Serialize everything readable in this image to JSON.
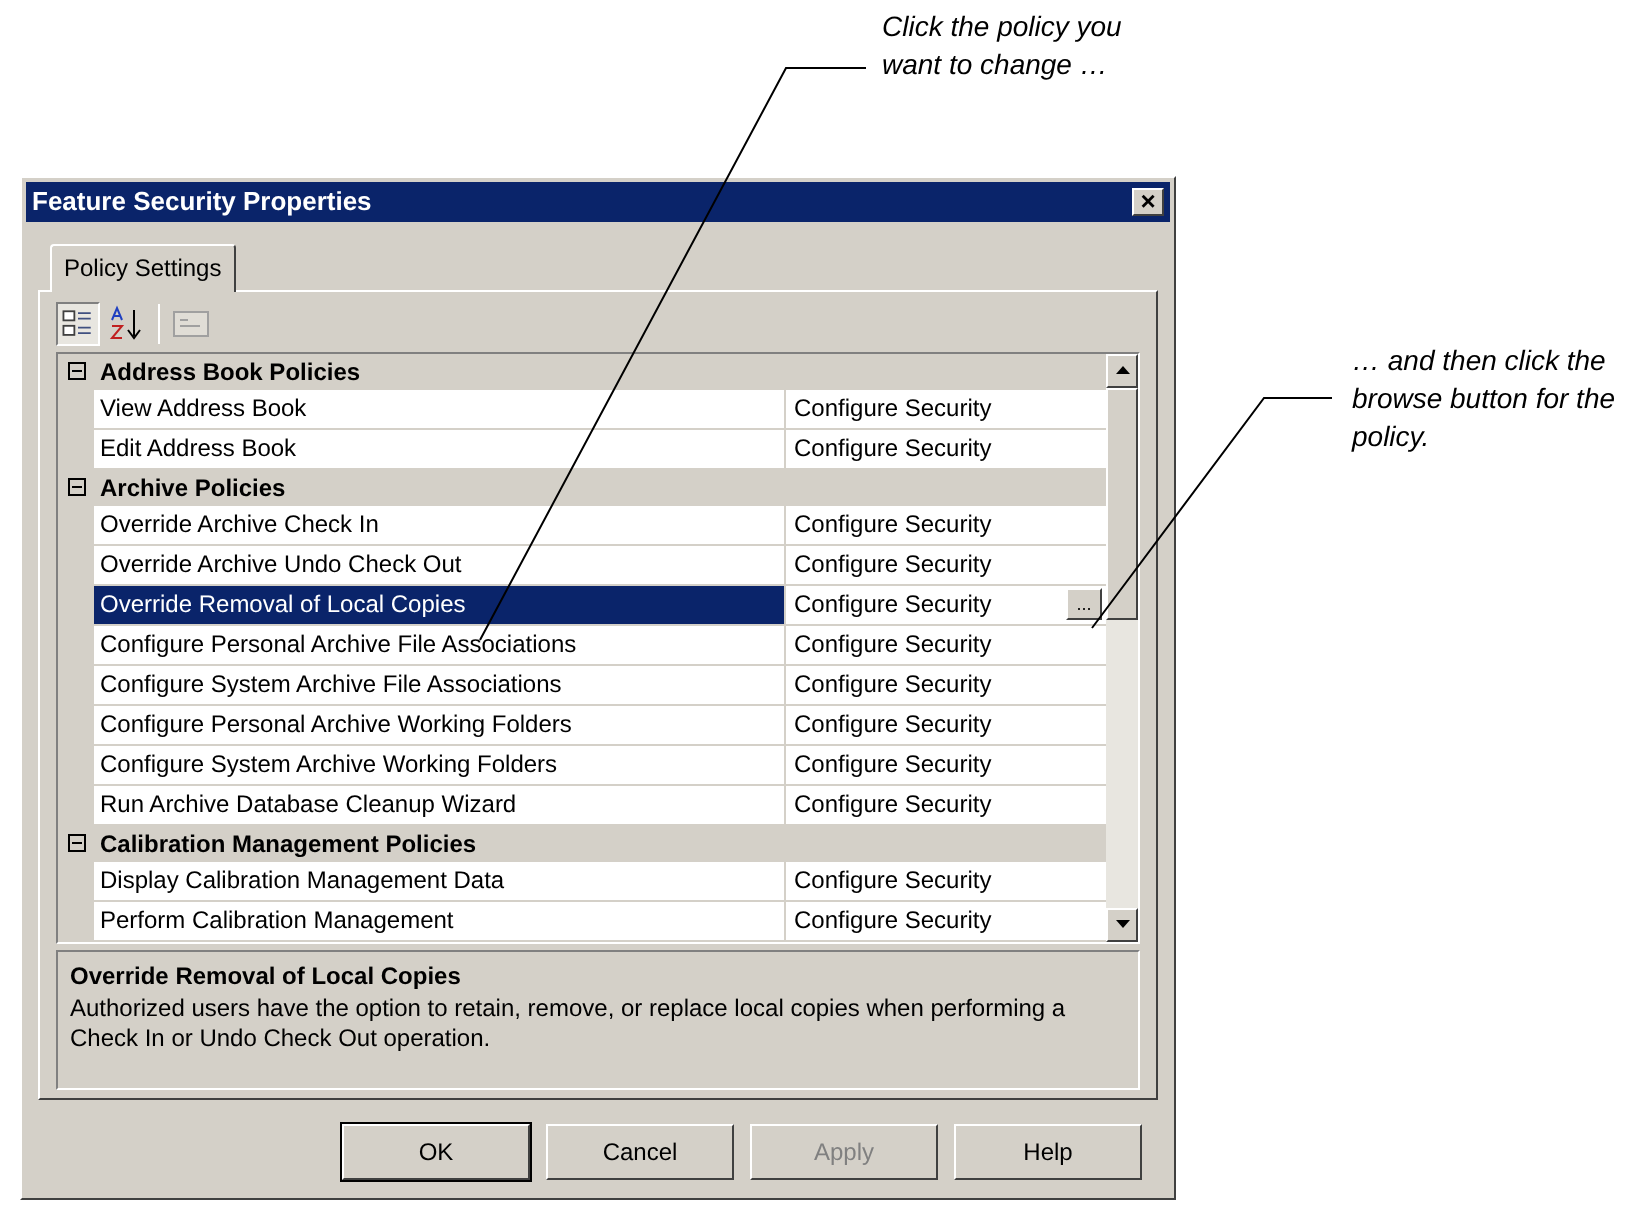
{
  "callouts": [
    {
      "text": "Click the policy you want to change …"
    },
    {
      "text": "… and then click the browse button for the policy."
    }
  ],
  "window": {
    "title": "Feature Security Properties",
    "close": "×"
  },
  "tabs": [
    {
      "label": "Policy Settings",
      "selected": true
    }
  ],
  "grid": {
    "groups": [
      {
        "name": "Address Book Policies",
        "expanded": true,
        "items": [
          {
            "name": "View Address Book",
            "value": "Configure Security",
            "selected": false
          },
          {
            "name": "Edit Address Book",
            "value": "Configure Security",
            "selected": false
          }
        ]
      },
      {
        "name": "Archive Policies",
        "expanded": true,
        "items": [
          {
            "name": "Override Archive Check In",
            "value": "Configure Security",
            "selected": false
          },
          {
            "name": "Override Archive Undo Check Out",
            "value": "Configure Security",
            "selected": false
          },
          {
            "name": "Override Removal of Local Copies",
            "value": "Configure Security",
            "selected": true,
            "browse": "..."
          },
          {
            "name": "Configure Personal Archive File Associations",
            "value": "Configure Security",
            "selected": false
          },
          {
            "name": "Configure System Archive File Associations",
            "value": "Configure Security",
            "selected": false
          },
          {
            "name": "Configure Personal Archive Working Folders",
            "value": "Configure Security",
            "selected": false
          },
          {
            "name": "Configure System Archive Working Folders",
            "value": "Configure Security",
            "selected": false
          },
          {
            "name": "Run Archive Database Cleanup Wizard",
            "value": "Configure Security",
            "selected": false
          }
        ]
      },
      {
        "name": "Calibration Management Policies",
        "expanded": true,
        "items": [
          {
            "name": "Display Calibration Management Data",
            "value": "Configure Security",
            "selected": false
          },
          {
            "name": "Perform Calibration Management",
            "value": "Configure Security",
            "selected": false
          }
        ]
      }
    ]
  },
  "description": {
    "title": "Override Removal of Local Copies",
    "text": "Authorized users have the option to retain, remove, or replace local copies when performing a Check In or Undo Check Out operation."
  },
  "buttons": [
    {
      "label": "OK",
      "disabled": false,
      "default": true
    },
    {
      "label": "Cancel",
      "disabled": false,
      "default": false
    },
    {
      "label": "Apply",
      "disabled": true,
      "default": false
    },
    {
      "label": "Help",
      "disabled": false,
      "default": false
    }
  ]
}
